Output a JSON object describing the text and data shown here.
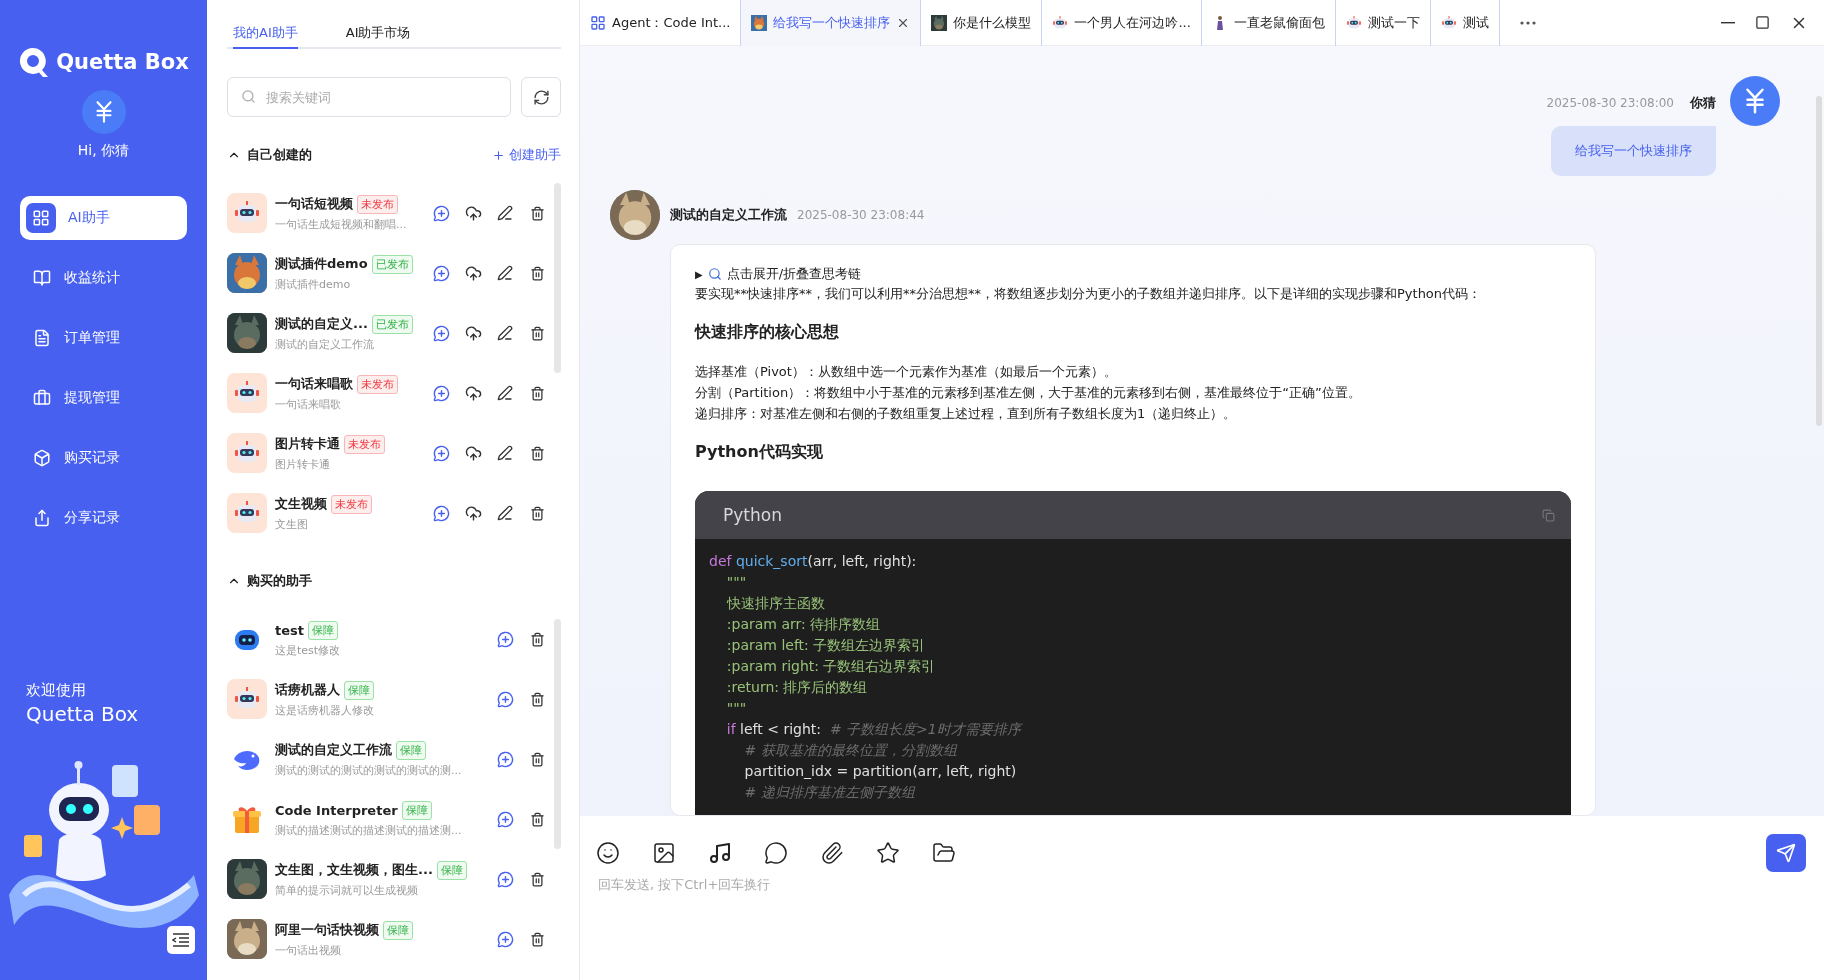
{
  "sidebar": {
    "logo": "Quetta Box",
    "greeting": "Hi, 你猜",
    "items": [
      {
        "label": "AI助手",
        "selected": true
      },
      {
        "label": "收益统计",
        "selected": false
      },
      {
        "label": "订单管理",
        "selected": false
      },
      {
        "label": "提现管理",
        "selected": false
      },
      {
        "label": "购买记录",
        "selected": false
      },
      {
        "label": "分享记录",
        "selected": false
      }
    ],
    "welcome": "欢迎使用",
    "product": "Quetta Box"
  },
  "assistants": {
    "tabs": [
      {
        "label": "我的AI助手",
        "selected": true
      },
      {
        "label": "AI助手市场",
        "selected": false
      }
    ],
    "search": {
      "placeholder": "搜索关键词"
    },
    "sections": [
      {
        "title": "自己创建的",
        "expanded": true,
        "action": "创建助手",
        "kind": "own",
        "items": [
          {
            "name": "一句话短视频",
            "status": "未发布",
            "published": false,
            "desc": "一句话生成短视频和翻唱..."
          },
          {
            "name": "测试插件demo",
            "status": "已发布",
            "published": true,
            "desc": "测试插件demo"
          },
          {
            "name": "测试的自定义...",
            "status": "已发布",
            "published": true,
            "desc": "测试的自定义工作流"
          },
          {
            "name": "一句话来唱歌",
            "status": "未发布",
            "published": false,
            "desc": "一句话来唱歌"
          },
          {
            "name": "图片转卡通",
            "status": "未发布",
            "published": false,
            "desc": "图片转卡通"
          },
          {
            "name": "文生视频",
            "status": "未发布",
            "published": false,
            "desc": "文生图"
          }
        ]
      },
      {
        "title": "购买的助手",
        "expanded": true,
        "kind": "bought",
        "items": [
          {
            "name": "test",
            "status": "保障",
            "published": true,
            "desc": "这是test修改"
          },
          {
            "name": "话痨机器人",
            "status": "保障",
            "published": true,
            "desc": "这是话痨机器人修改"
          },
          {
            "name": "测试的自定义工作流",
            "status": "保障",
            "published": true,
            "desc": "测试的测试的测试的测试的测试的测..."
          },
          {
            "name": "Code Interpreter",
            "status": "保障",
            "published": true,
            "desc": "测试的描述测试的描述测试的描述测..."
          },
          {
            "name": "文生图，文生视频，图生...",
            "status": "保障",
            "published": true,
            "desc": "简单的提示词就可以生成视频"
          },
          {
            "name": "阿里一句话快视频",
            "status": "保障",
            "published": true,
            "desc": "一句话出视频"
          }
        ]
      }
    ]
  },
  "tabs": [
    {
      "label": "Agent：Code Int...",
      "selected": false
    },
    {
      "label": "给我写一个快速排序",
      "selected": true
    },
    {
      "label": "你是什么模型",
      "selected": false
    },
    {
      "label": "一个男人在河边吟...",
      "selected": false
    },
    {
      "label": "一直老鼠偷面包",
      "selected": false
    },
    {
      "label": "测试一下",
      "selected": false
    },
    {
      "label": "测试",
      "selected": false
    }
  ],
  "chat": {
    "user": {
      "time": "2025-08-30 23:08:00",
      "name": "你猜",
      "text": "给我写一个快速排序"
    },
    "bot": {
      "name": "测试的自定义工作流",
      "time": "2025-08-30 23:08:44",
      "toggle_mark": "▶",
      "toggle": "点击展开/折叠查思考链",
      "intro": "要实现**快速排序**，我们可以利用**分治思想**，将数组逐步划分为更小的子数组并递归排序。以下是详细的实现步骤和Python代码：",
      "heading_1": "快速排序的核心思想",
      "points": [
        "选择基准（Pivot）：从数组中选一个元素作为基准（如最后一个元素）。",
        "分割（Partition）：将数组中小于基准的元素移到基准左侧，大于基准的元素移到右侧，基准最终位于“正确”位置。",
        "递归排序：对基准左侧和右侧的子数组重复上述过程，直到所有子数组长度为1（递归终止）。"
      ],
      "heading_2": "Python代码实现",
      "code": {
        "language": "Python",
        "lines": [
          [
            {
              "kind": "keyword",
              "text": "def "
            },
            {
              "kind": "func",
              "text": "quick_sort"
            },
            {
              "kind": "plain",
              "text": "(arr, left, right):"
            }
          ],
          [
            {
              "kind": "string",
              "text": "    \"\"\""
            }
          ],
          [
            {
              "kind": "string",
              "text": "    快速排序主函数"
            }
          ],
          [
            {
              "kind": "string",
              "text": "    :param arr: 待排序数组"
            }
          ],
          [
            {
              "kind": "string",
              "text": "    :param left: 子数组左边界索引"
            }
          ],
          [
            {
              "kind": "string",
              "text": "    :param right: 子数组右边界索引"
            }
          ],
          [
            {
              "kind": "string",
              "text": "    :return: 排序后的数组"
            }
          ],
          [
            {
              "kind": "string",
              "text": "    \"\"\""
            }
          ],
          [
            {
              "kind": "keyword",
              "text": "    if"
            },
            {
              "kind": "plain",
              "text": " left < right:  "
            },
            {
              "kind": "comment",
              "text": "# 子数组长度>1时才需要排序"
            }
          ],
          [
            {
              "kind": "comment",
              "text": "        # 获取基准的最终位置，分割数组"
            }
          ],
          [
            {
              "kind": "plain",
              "text": "        partition_idx = partition(arr, left, right)"
            }
          ],
          [
            {
              "kind": "comment",
              "text": "        # 递归排序基准左侧子数组"
            }
          ]
        ]
      }
    }
  },
  "composer": {
    "placeholder": "回车发送, 按下Ctrl+回车换行"
  }
}
